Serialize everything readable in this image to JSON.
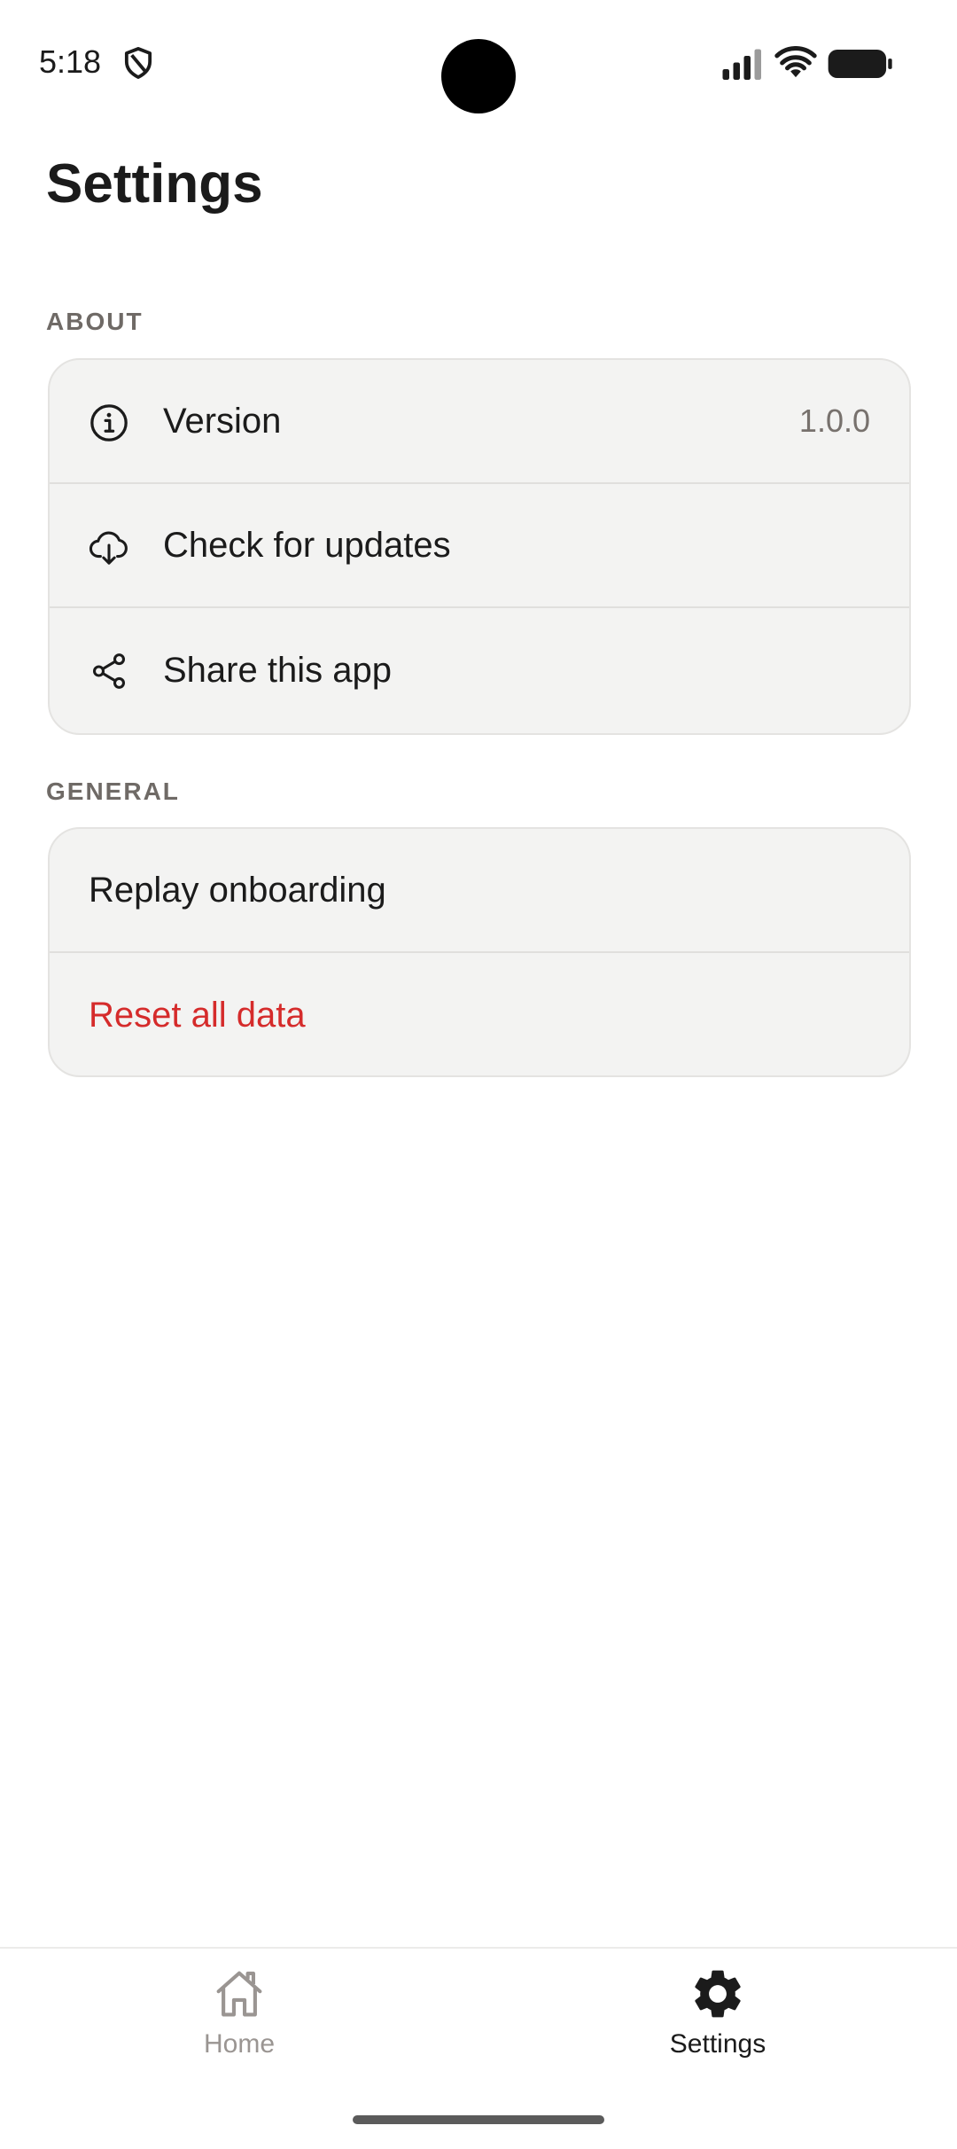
{
  "status_bar": {
    "time": "5:18",
    "icons": [
      "shield-icon",
      "signal-icon",
      "wifi-icon",
      "battery-icon"
    ]
  },
  "header": {
    "title": "Settings"
  },
  "sections": {
    "about": {
      "label": "ABOUT",
      "items": [
        {
          "icon": "info-icon",
          "label": "Version",
          "value": "1.0.0"
        },
        {
          "icon": "cloud-download-icon",
          "label": "Check for updates"
        },
        {
          "icon": "share-icon",
          "label": "Share this app"
        }
      ]
    },
    "general": {
      "label": "GENERAL",
      "items": [
        {
          "label": "Replay onboarding"
        },
        {
          "label": "Reset all data",
          "color": "#d52b2b"
        }
      ]
    }
  },
  "bottom_nav": {
    "items": [
      {
        "icon": "home-icon",
        "label": "Home",
        "active": false
      },
      {
        "icon": "gear-icon",
        "label": "Settings",
        "active": true
      }
    ]
  },
  "colors": {
    "danger": "#d52b2b",
    "card_background": "#f3f3f2",
    "section_label": "#6f6a66",
    "inactive_nav": "#9a9592"
  }
}
